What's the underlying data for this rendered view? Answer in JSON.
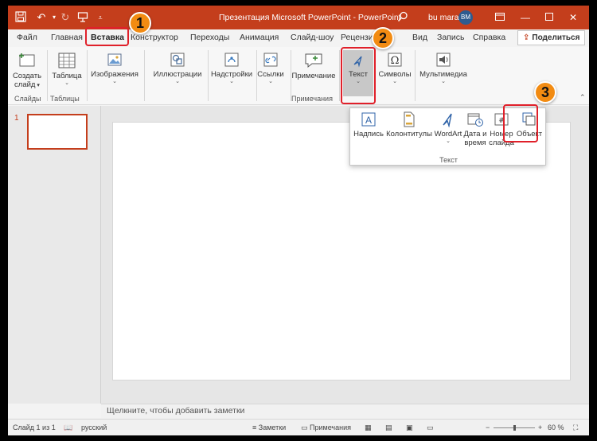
{
  "app": {
    "title": "Презентация Microsoft PowerPoint  -  PowerPoint",
    "user_name": "bu mara",
    "user_initials": "BM",
    "brand_color": "#c43e1c"
  },
  "quick_access": {
    "icons": [
      "save-icon",
      "undo-icon",
      "redo-icon",
      "present-icon",
      "customize-icon"
    ]
  },
  "menu": {
    "tabs": [
      "Файл",
      "Главная",
      "Вставка",
      "Конструктор",
      "Переходы",
      "Анимация",
      "Слайд-шоу",
      "Рецензирование",
      "Вид",
      "Запись",
      "Справка"
    ],
    "rec_partial": "Рецензи",
    "active_tab": "Вставка",
    "share_label": "Поделиться"
  },
  "ribbon": {
    "new_slide_line1": "Создать",
    "new_slide_line2": "слайд",
    "group_slides": "Слайды",
    "table": "Таблица",
    "group_tables": "Таблицы",
    "images": "Изображения",
    "illustrations": "Иллюстрации",
    "addins": "Надстройки",
    "links": "Ссылки",
    "comment": "Примечание",
    "group_comments": "Примечания",
    "text": "Текст",
    "symbols": "Символы",
    "media": "Мультимедиа"
  },
  "dropdown": {
    "textbox": "Надпись",
    "header_footer": "Колонтитулы",
    "wordart": "WordArt",
    "datetime_line1": "Дата и",
    "datetime_line2": "время",
    "slide_number_line1": "Номер",
    "slide_number_line2": "слайда",
    "object": "Объект",
    "group_label": "Текст"
  },
  "slides_pane": {
    "slide_number": "1"
  },
  "notes": {
    "placeholder": "Щелкните, чтобы добавить заметки"
  },
  "status": {
    "slide_info": "Слайд 1 из 1",
    "language": "русский",
    "notes_btn": "Заметки",
    "comments_btn": "Примечания",
    "zoom": "60 %",
    "zoom_level": 0.6
  },
  "annotations": {
    "step1": "1",
    "step2": "2",
    "step3": "3",
    "highlight_color": "#e0202a",
    "badge_color": "#f28b12"
  }
}
